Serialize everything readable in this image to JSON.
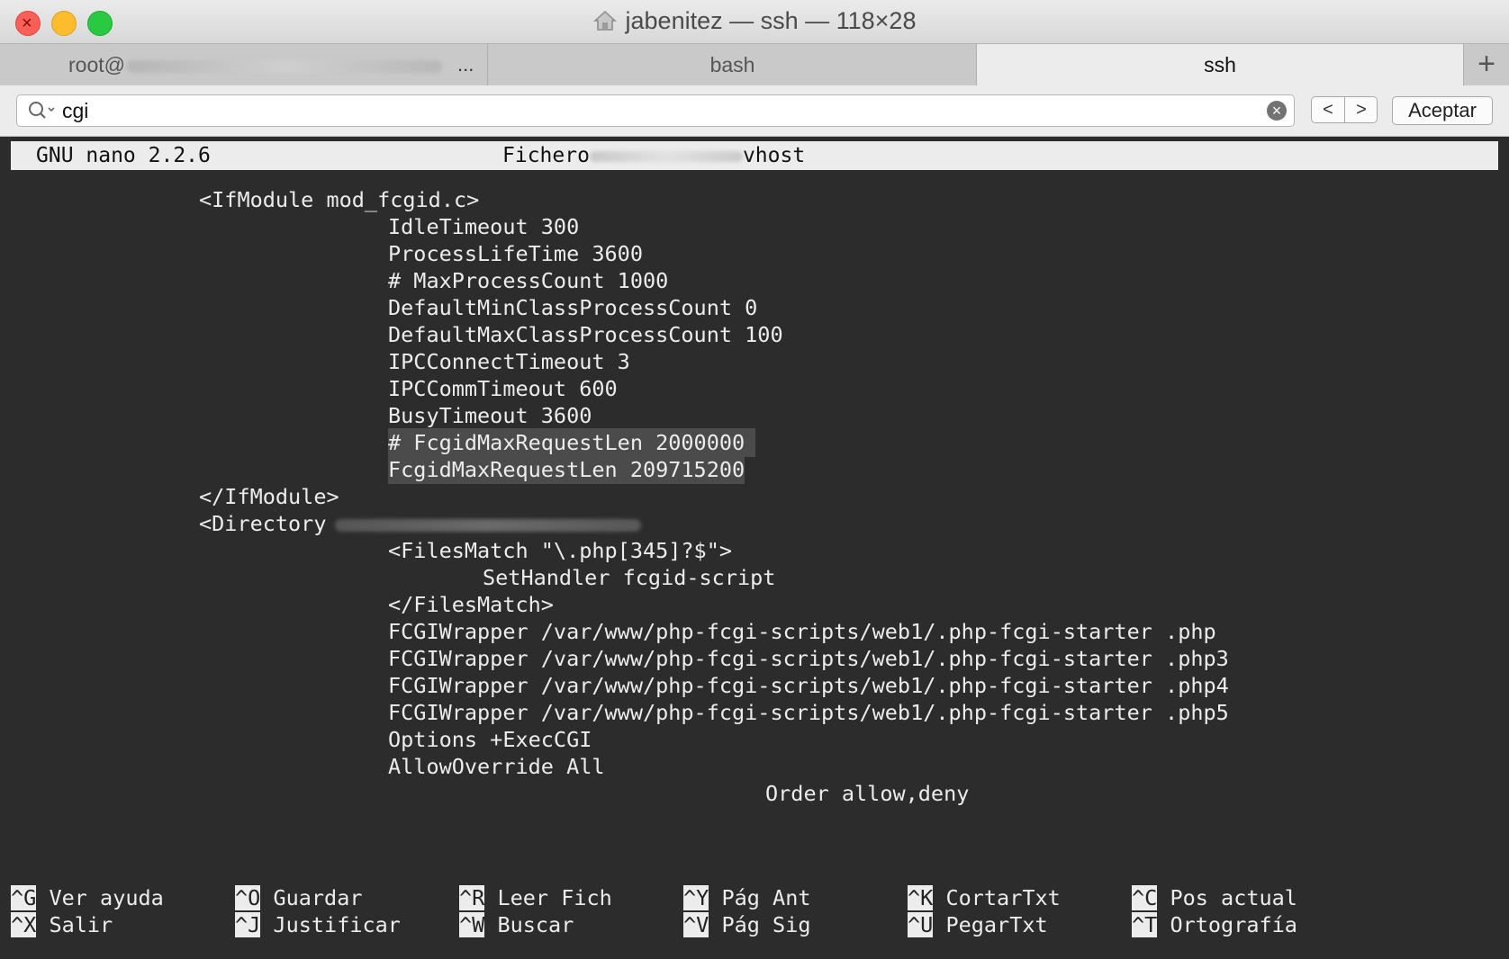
{
  "window": {
    "title": "jabenitez — ssh — 118×28"
  },
  "tabs": [
    {
      "label": "root@",
      "trailing": "..."
    },
    {
      "label": "bash"
    },
    {
      "label": "ssh",
      "active": true
    }
  ],
  "new_tab_label": "+",
  "find": {
    "query": "cgi",
    "accept_label": "Aceptar",
    "prev_label": "<",
    "next_label": ">"
  },
  "nano": {
    "version": "GNU nano 2.2.6",
    "file_prefix": "Fichero",
    "file_suffix": "vhost"
  },
  "code_lines": [
    "<IfModule mod_fcgid.c>",
    "IdleTimeout 300",
    "ProcessLifeTime 3600",
    "# MaxProcessCount 1000",
    "DefaultMinClassProcessCount 0",
    "DefaultMaxClassProcessCount 100",
    "IPCConnectTimeout 3",
    "IPCCommTimeout 600",
    "BusyTimeout 3600",
    "# FcgidMaxRequestLen 2000000",
    "FcgidMaxRequestLen 209715200",
    "</IfModule>",
    "<Directory",
    "<FilesMatch \"\\.php[345]?$\">",
    "SetHandler fcgid-script",
    "</FilesMatch>",
    "FCGIWrapper /var/www/php-fcgi-scripts/web1/.php-fcgi-starter .php",
    "FCGIWrapper /var/www/php-fcgi-scripts/web1/.php-fcgi-starter .php3",
    "FCGIWrapper /var/www/php-fcgi-scripts/web1/.php-fcgi-starter .php4",
    "FCGIWrapper /var/www/php-fcgi-scripts/web1/.php-fcgi-starter .php5",
    "Options +ExecCGI",
    "AllowOverride All",
    "Order allow,deny"
  ],
  "shortcuts": [
    {
      "key": "^G",
      "label": "Ver ayuda"
    },
    {
      "key": "^O",
      "label": "Guardar"
    },
    {
      "key": "^R",
      "label": "Leer Fich"
    },
    {
      "key": "^Y",
      "label": "Pág Ant"
    },
    {
      "key": "^K",
      "label": "CortarTxt"
    },
    {
      "key": "^C",
      "label": "Pos actual"
    },
    {
      "key": "^X",
      "label": "Salir"
    },
    {
      "key": "^J",
      "label": "Justificar"
    },
    {
      "key": "^W",
      "label": "Buscar"
    },
    {
      "key": "^V",
      "label": "Pág Sig"
    },
    {
      "key": "^U",
      "label": "PegarTxt"
    },
    {
      "key": "^T",
      "label": "Ortografía"
    }
  ]
}
